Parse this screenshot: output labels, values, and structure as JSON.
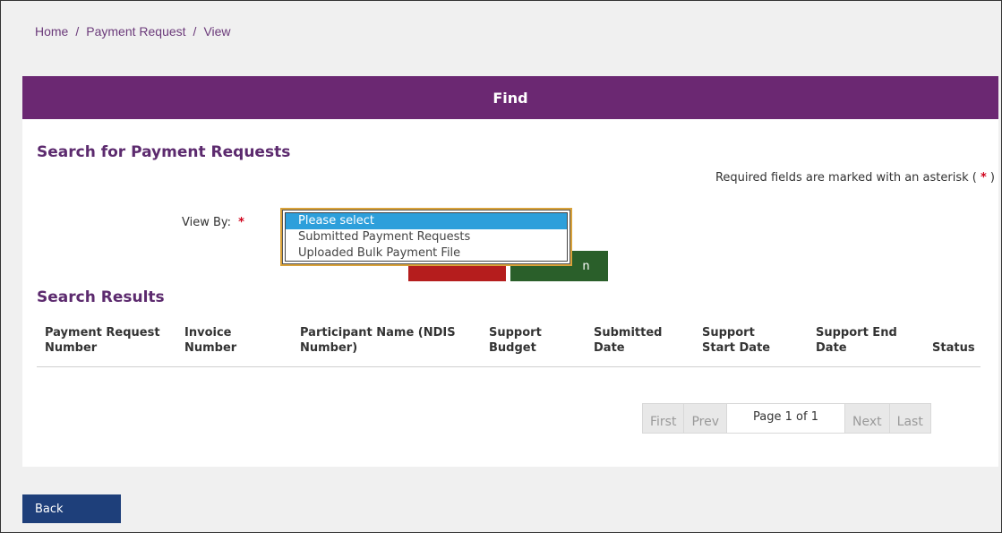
{
  "breadcrumb": {
    "items": [
      "Home",
      "Payment Request",
      "View"
    ],
    "separator": "/"
  },
  "panel": {
    "header": "Find",
    "search_title": "Search for Payment Requests",
    "required_note": "Required fields are marked with an asterisk (",
    "required_star": "*",
    "required_close": ")"
  },
  "form": {
    "view_by_label": "View By:",
    "view_by_star": "*",
    "view_by_options": [
      "Please select",
      "Submitted Payment Requests",
      "Uploaded Bulk Payment File"
    ],
    "selected_index": 0,
    "green_button_visible_text": "n"
  },
  "results": {
    "title": "Search Results",
    "columns": [
      "Payment Request Number",
      "Invoice Number",
      "Participant Name (NDIS Number)",
      "Support Budget",
      "Submitted Date",
      "Support Start Date",
      "Support End Date",
      "Status"
    ],
    "rows": []
  },
  "pagination": {
    "first": "First",
    "prev": "Prev",
    "info": "Page 1 of 1",
    "next": "Next",
    "last": "Last"
  },
  "footer": {
    "back_label": "Back"
  },
  "colors": {
    "header_bg": "#6b2872",
    "title_color": "#5c2a6e",
    "selected_option": "#2d9fdb",
    "back_button": "#1e3f7a",
    "red_button": "#b51d1d",
    "green_button": "#2a5f2a"
  }
}
